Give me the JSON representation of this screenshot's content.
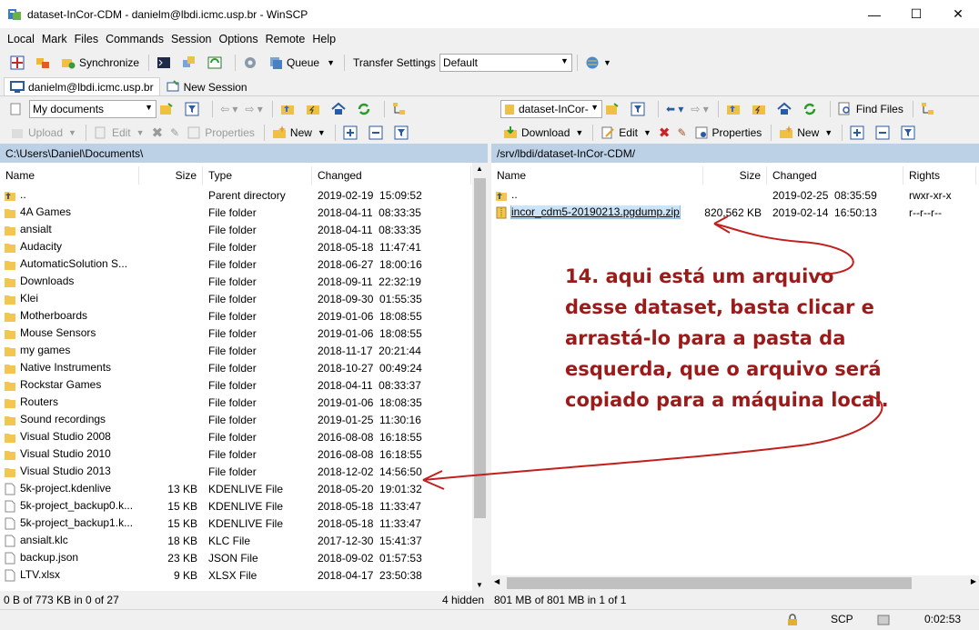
{
  "window": {
    "title": "dataset-InCor-CDM - danielm@lbdi.icmc.usp.br - WinSCP",
    "minimize": "—",
    "maximize": "☐",
    "close": "✕"
  },
  "menu": [
    "Local",
    "Mark",
    "Files",
    "Commands",
    "Session",
    "Options",
    "Remote",
    "Help"
  ],
  "toolbar1": {
    "synchronize": "Synchronize",
    "queue": "Queue",
    "transfer_label": "Transfer Settings",
    "transfer_value": "Default"
  },
  "tabs": {
    "session": "danielm@lbdi.icmc.usp.br",
    "new_session": "New Session"
  },
  "left": {
    "location": "My documents",
    "upload": "Upload",
    "edit": "Edit",
    "properties": "Properties",
    "new": "New",
    "path": "C:\\Users\\Daniel\\Documents\\",
    "headers": {
      "name": "Name",
      "size": "Size",
      "type": "Type",
      "changed": "Changed"
    },
    "rows": [
      {
        "name": "..",
        "size": "",
        "type": "Parent directory",
        "changed": "2019-02-19  15:09:52",
        "icon": "up-folder"
      },
      {
        "name": "4A Games",
        "size": "",
        "type": "File folder",
        "changed": "2018-04-11  08:33:35",
        "icon": "folder"
      },
      {
        "name": "ansialt",
        "size": "",
        "type": "File folder",
        "changed": "2018-04-11  08:33:35",
        "icon": "folder"
      },
      {
        "name": "Audacity",
        "size": "",
        "type": "File folder",
        "changed": "2018-05-18  11:47:41",
        "icon": "folder"
      },
      {
        "name": "AutomaticSolution S...",
        "size": "",
        "type": "File folder",
        "changed": "2018-06-27  18:00:16",
        "icon": "folder"
      },
      {
        "name": "Downloads",
        "size": "",
        "type": "File folder",
        "changed": "2018-09-11  22:32:19",
        "icon": "folder"
      },
      {
        "name": "Klei",
        "size": "",
        "type": "File folder",
        "changed": "2018-09-30  01:55:35",
        "icon": "folder"
      },
      {
        "name": "Motherboards",
        "size": "",
        "type": "File folder",
        "changed": "2019-01-06  18:08:55",
        "icon": "folder"
      },
      {
        "name": "Mouse Sensors",
        "size": "",
        "type": "File folder",
        "changed": "2019-01-06  18:08:55",
        "icon": "folder"
      },
      {
        "name": "my games",
        "size": "",
        "type": "File folder",
        "changed": "2018-11-17  20:21:44",
        "icon": "folder"
      },
      {
        "name": "Native Instruments",
        "size": "",
        "type": "File folder",
        "changed": "2018-10-27  00:49:24",
        "icon": "folder"
      },
      {
        "name": "Rockstar Games",
        "size": "",
        "type": "File folder",
        "changed": "2018-04-11  08:33:37",
        "icon": "folder"
      },
      {
        "name": "Routers",
        "size": "",
        "type": "File folder",
        "changed": "2019-01-06  18:08:35",
        "icon": "folder"
      },
      {
        "name": "Sound recordings",
        "size": "",
        "type": "File folder",
        "changed": "2019-01-25  11:30:16",
        "icon": "folder"
      },
      {
        "name": "Visual Studio 2008",
        "size": "",
        "type": "File folder",
        "changed": "2016-08-08  16:18:55",
        "icon": "folder"
      },
      {
        "name": "Visual Studio 2010",
        "size": "",
        "type": "File folder",
        "changed": "2016-08-08  16:18:55",
        "icon": "folder"
      },
      {
        "name": "Visual Studio 2013",
        "size": "",
        "type": "File folder",
        "changed": "2018-12-02  14:56:50",
        "icon": "folder"
      },
      {
        "name": "5k-project.kdenlive",
        "size": "13 KB",
        "type": "KDENLIVE File",
        "changed": "2018-05-20  19:01:32",
        "icon": "file"
      },
      {
        "name": "5k-project_backup0.k...",
        "size": "15 KB",
        "type": "KDENLIVE File",
        "changed": "2018-05-18  11:33:47",
        "icon": "file"
      },
      {
        "name": "5k-project_backup1.k...",
        "size": "15 KB",
        "type": "KDENLIVE File",
        "changed": "2018-05-18  11:33:47",
        "icon": "file"
      },
      {
        "name": "ansialt.klc",
        "size": "18 KB",
        "type": "KLC File",
        "changed": "2017-12-30  15:41:37",
        "icon": "file"
      },
      {
        "name": "backup.json",
        "size": "23 KB",
        "type": "JSON File",
        "changed": "2018-09-02  01:57:53",
        "icon": "file"
      },
      {
        "name": "LTV.xlsx",
        "size": "9 KB",
        "type": "XLSX File",
        "changed": "2018-04-17  23:50:38",
        "icon": "file"
      }
    ],
    "status": "0 B of 773 KB in 0 of 27",
    "hidden": "4 hidden"
  },
  "right": {
    "location": "dataset-InCor-",
    "download": "Download",
    "edit": "Edit",
    "properties": "Properties",
    "new": "New",
    "find": "Find Files",
    "path": "/srv/lbdi/dataset-InCor-CDM/",
    "headers": {
      "name": "Name",
      "size": "Size",
      "changed": "Changed",
      "rights": "Rights"
    },
    "rows": [
      {
        "name": "..",
        "size": "",
        "changed": "2019-02-25  08:35:59",
        "rights": "rwxr-xr-x",
        "icon": "up-folder"
      },
      {
        "name": "incor_cdm5-20190213.pgdump.zip",
        "size": "820,562 KB",
        "changed": "2019-02-14  16:50:13",
        "rights": "r--r--r--",
        "icon": "zip-file"
      }
    ],
    "status": "801 MB of 801 MB in 1 of 1"
  },
  "bottom": {
    "protocol": "SCP",
    "elapsed": "0:02:53"
  },
  "annotation": {
    "lines": [
      "14. aqui está um arquivo",
      "desse dataset, basta clicar e",
      "arrastá-lo para a pasta da",
      "esquerda, que o arquivo será",
      "copiado para a máquina local."
    ],
    "color": "#9b1b1b"
  }
}
